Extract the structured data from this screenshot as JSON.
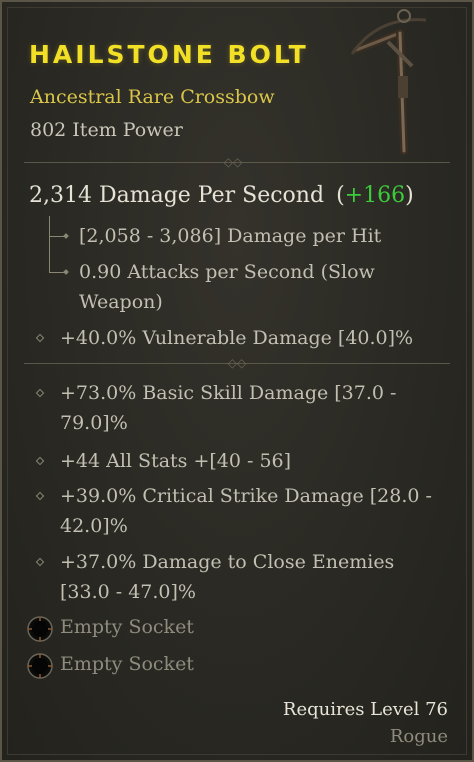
{
  "item": {
    "name": "HAILSTONE BOLT",
    "type": "Ancestral Rare Crossbow",
    "power": "802 Item Power"
  },
  "dps": {
    "value": "2,314 Damage Per Second",
    "delta_open": "(",
    "delta": "+166",
    "delta_close": ")"
  },
  "weapon_stats": [
    "[2,058 - 3,086] Damage per Hit",
    "0.90 Attacks per Second (Slow",
    "Weapon)"
  ],
  "implicit": "+40.0% Vulnerable Damage [40.0]%",
  "affixes": [
    [
      "+73.0% Basic Skill Damage [37.0 -",
      "79.0]%"
    ],
    [
      "+44 All Stats +[40 - 56]"
    ],
    [
      "+39.0% Critical Strike Damage [28.0 -",
      "42.0]%"
    ],
    [
      "+37.0% Damage to Close Enemies",
      "[33.0 - 47.0]%"
    ]
  ],
  "sockets": [
    "Empty Socket",
    "Empty Socket"
  ],
  "requirements": {
    "level": "Requires Level 76",
    "class": "Rogue"
  },
  "colors": {
    "title": "#f2e027",
    "rare_type": "#d9c64a",
    "upgrade": "#3ccb3c",
    "text": "#c3bfb2",
    "muted": "#8f8b7e"
  },
  "icons": {
    "item_image": "crossbow-icon",
    "socket": "socket-icon",
    "bullet": "diamond-bullet-icon"
  }
}
